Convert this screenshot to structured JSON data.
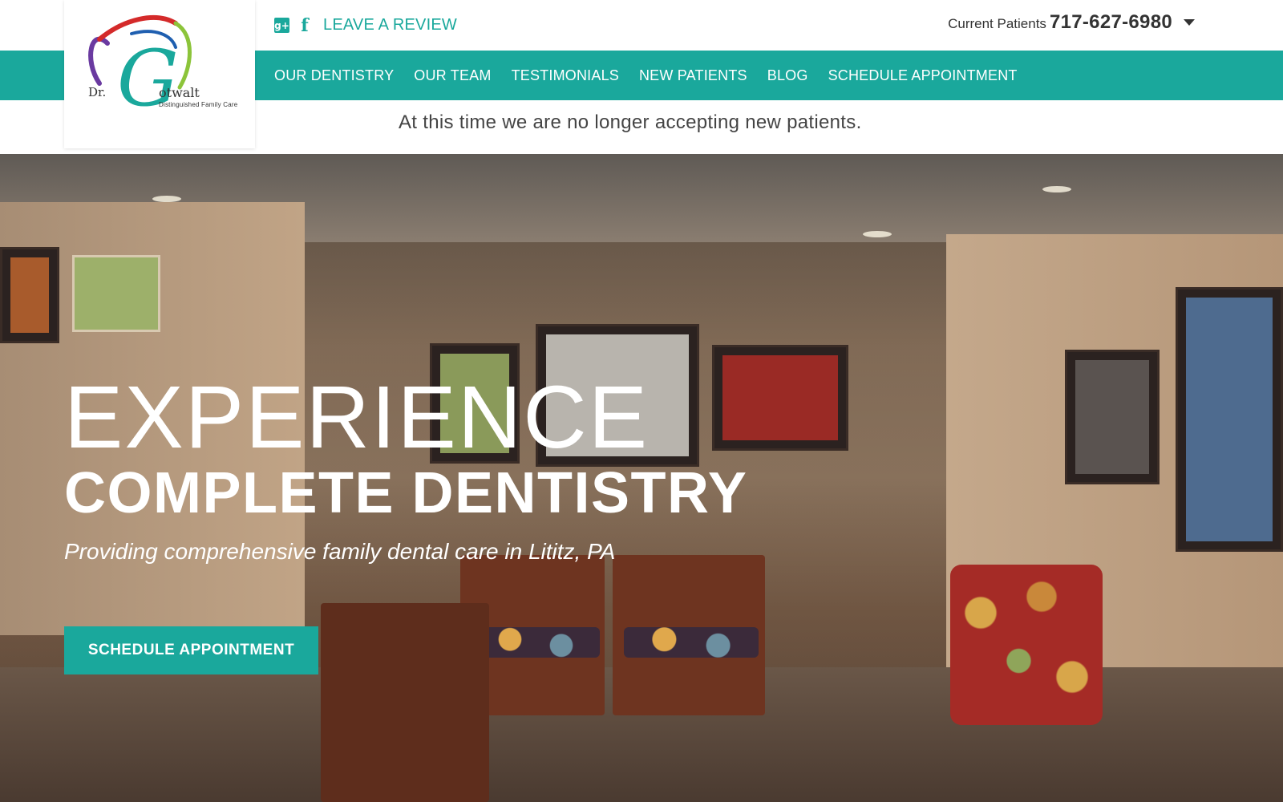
{
  "brand": {
    "logo_dr": "Dr.",
    "logo_name": "otwalt",
    "logo_initial": "G",
    "logo_tagline": "Distinguished Family Care"
  },
  "topbar": {
    "social_icons": [
      "google-plus-icon",
      "facebook-icon"
    ],
    "gplus_glyph": "g+",
    "fb_glyph": "f",
    "review_label": "LEAVE A REVIEW",
    "phone_label": "Current Patients",
    "phone_number": "717-627-6980"
  },
  "nav": {
    "items": [
      {
        "label": "OUR DENTISTRY"
      },
      {
        "label": "OUR TEAM"
      },
      {
        "label": "TESTIMONIALS"
      },
      {
        "label": "NEW PATIENTS"
      },
      {
        "label": "BLOG"
      },
      {
        "label": "SCHEDULE APPOINTMENT"
      }
    ]
  },
  "notice": {
    "text": "At this time we are no longer accepting new patients."
  },
  "hero": {
    "line1": "EXPERIENCE",
    "line2": "COMPLETE DENTISTRY",
    "subtitle": "Providing comprehensive family dental care in Lititz, PA",
    "cta_label": "SCHEDULE APPOINTMENT"
  },
  "colors": {
    "accent": "#1aa89c",
    "text_dark": "#333333",
    "hero_text": "#ffffff"
  }
}
